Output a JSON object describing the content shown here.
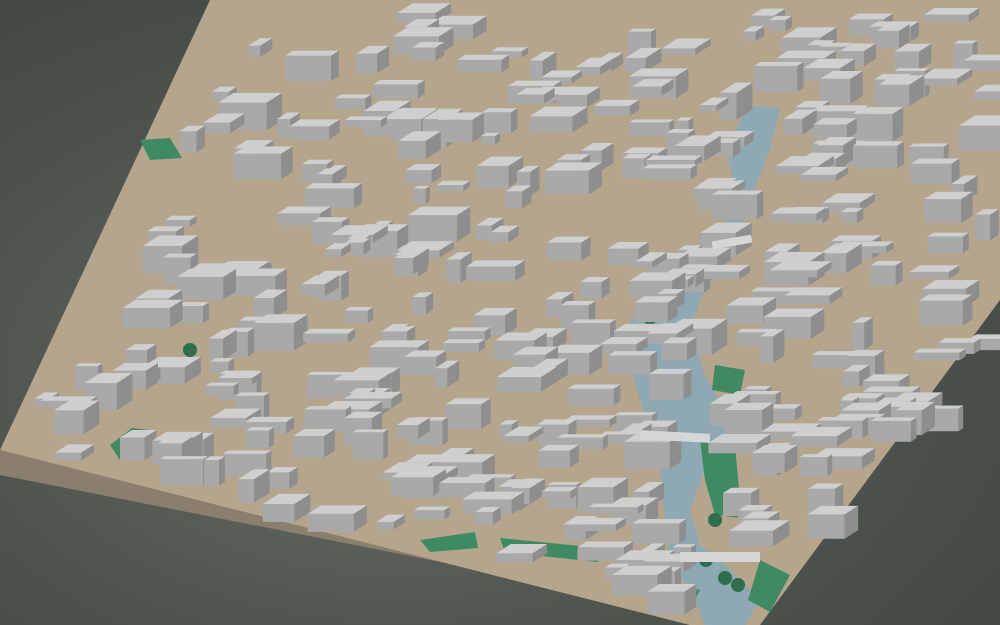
{
  "scene": {
    "kind": "3d-city-block-model",
    "text_labels": []
  },
  "colors": {
    "background": "#545954",
    "base_side": "#8a7e6c",
    "ground": "#b5a58c",
    "building_top": "#cfcfcf",
    "building_side": "#a9a9a9",
    "building_shadow": "#8e8e8e",
    "river": "#8fa9b4",
    "park": "#3f8a63",
    "tree": "#2f6e4d"
  },
  "features": {
    "river": "river-winding-through-east-side",
    "parks": [
      "southwest-park",
      "south-park",
      "riverside-park"
    ],
    "bridges": [
      "north-bridge",
      "middle-bridge",
      "south-bridge"
    ]
  }
}
